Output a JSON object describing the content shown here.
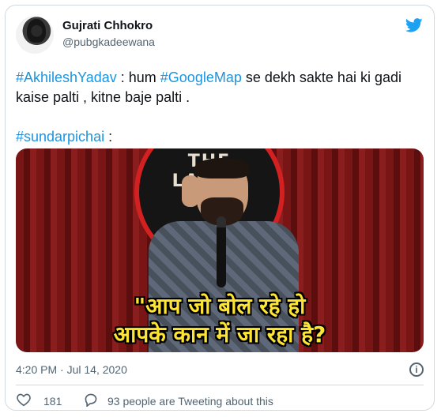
{
  "tweet": {
    "display_name": "Gujrati Chhokro",
    "handle": "@pubgkadeewana",
    "text_parts": [
      {
        "text": "#AkhileshYadav",
        "tag": true
      },
      {
        "text": " : hum ",
        "tag": false
      },
      {
        "text": "#GoogleMap",
        "tag": true
      },
      {
        "text": " se dekh sakte hai ki gadi kaise palti , kitne baje palti .\n\n",
        "tag": false
      },
      {
        "text": "#sundarpichai",
        "tag": true
      },
      {
        "text": " :",
        "tag": false
      }
    ],
    "media": {
      "logo_text": "THE LAUGH",
      "caption_line1": "\"आप जो बोल रहे हो",
      "caption_line2": "आपके कान में जा रहा है?"
    },
    "timestamp": "4:20 PM · Jul 14, 2020",
    "likes": "181",
    "talking": "93 people are Tweeting about this"
  },
  "icons": {
    "brand": "twitter-bird-icon",
    "info": "info-icon",
    "like": "heart-icon",
    "reply": "speech-bubble-icon"
  },
  "colors": {
    "accent": "#1b95e0",
    "text": "#0f1419",
    "muted": "#536471",
    "border": "#cfd9de"
  }
}
